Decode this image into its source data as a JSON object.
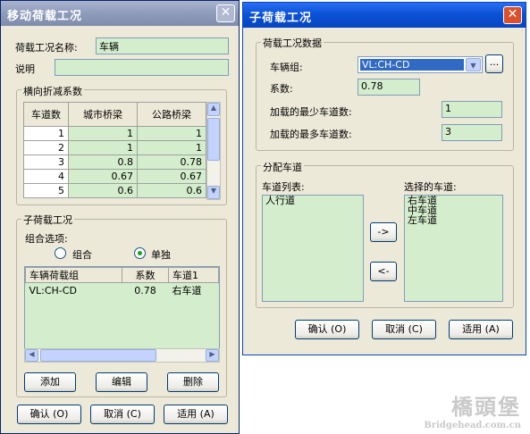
{
  "left_window": {
    "title": "移动荷载工况",
    "name_label": "荷载工况名称:",
    "name_value": "车辆",
    "desc_label": "说明",
    "desc_value": "",
    "reduction_group": "横向折减系数",
    "reduction_table": {
      "headers": [
        "车道数",
        "城市桥梁",
        "公路桥梁"
      ],
      "rows": [
        [
          "1",
          "1",
          "1"
        ],
        [
          "2",
          "1",
          "1"
        ],
        [
          "3",
          "0.8",
          "0.78"
        ],
        [
          "4",
          "0.67",
          "0.67"
        ],
        [
          "5",
          "0.6",
          "0.6"
        ]
      ]
    },
    "sub_group": "子荷载工况",
    "combo_option_label": "组合选项:",
    "radio_combine": "组合",
    "radio_single": "单独",
    "radio_selected": "单独",
    "sub_table": {
      "headers": [
        "车辆荷载组",
        "系数",
        "车道1"
      ],
      "rows": [
        [
          "VL:CH-CD",
          "0.78",
          "右车道"
        ]
      ]
    },
    "buttons": {
      "add": "添加",
      "edit": "编辑",
      "delete": "删除"
    },
    "ok": "确认 (O)",
    "cancel": "取消 (C)",
    "apply": "适用 (A)"
  },
  "right_window": {
    "title": "子荷载工况",
    "data_group": "荷载工况数据",
    "vehicle_group_label": "车辆组:",
    "vehicle_group_value": "VL:CH-CD",
    "browse_label": "...",
    "factor_label": "系数:",
    "factor_value": "0.78",
    "min_lanes_label": "加载的最少车道数:",
    "min_lanes_value": "1",
    "max_lanes_label": "加载的最多车道数:",
    "max_lanes_value": "3",
    "assign_group": "分配车道",
    "lane_list_label": "车道列表:",
    "lane_list": [
      "人行道"
    ],
    "selected_label": "选择的车道:",
    "selected_list": [
      "右车道",
      "中车道",
      "左车道"
    ],
    "add_arrow": "->",
    "remove_arrow": "<-",
    "ok": "确认 (O)",
    "cancel": "取消 (C)",
    "apply": "适用 (A)"
  },
  "watermark": {
    "logo": "橋頭堡",
    "url": "Bridgehead.com.cn"
  },
  "colors": {
    "field_green": "#d4edcc",
    "titlebar_active": "#0a52d8",
    "close_red": "#d9522d"
  }
}
